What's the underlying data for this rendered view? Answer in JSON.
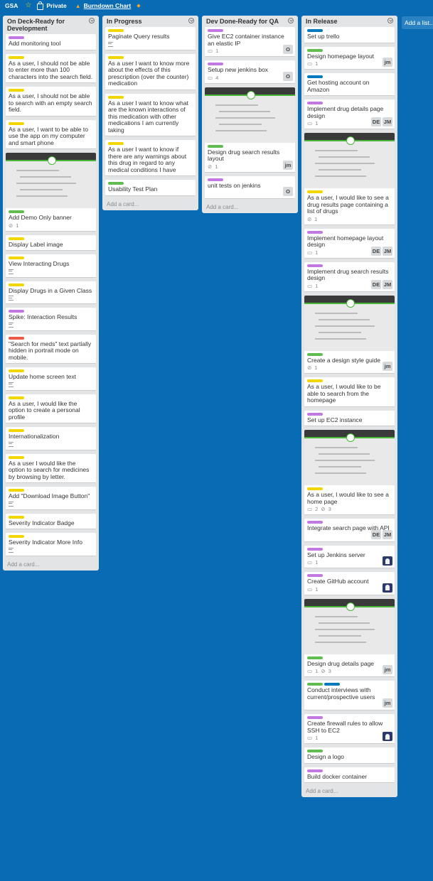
{
  "board": {
    "title": "GSA",
    "visibility": "Private",
    "link": "Burndown Chart",
    "add_list": "Add a list..."
  },
  "colors": {
    "background": "#0a6bb5",
    "yellow": "#f2d600",
    "purple": "#c377e0",
    "green": "#61bd4f",
    "blue": "#0079bf",
    "red": "#eb5a46"
  },
  "lists": [
    {
      "title": "On Deck-Ready for Development",
      "add_card": "Add a card...",
      "cards": [
        {
          "labels": [
            "purple"
          ],
          "title": "Add monitoring tool"
        },
        {
          "labels": [
            "yellow"
          ],
          "title": "As a user, I should not be able to enter more than 100 characters into the search field."
        },
        {
          "labels": [
            "yellow"
          ],
          "title": "As a user, I should not be able to search with an empty search field."
        },
        {
          "labels": [
            "yellow"
          ],
          "title": "As a user, I want to be able to use the app on my computer and smart phone"
        },
        {
          "labels": [
            "green"
          ],
          "title": "Add Demo Only banner",
          "attachments": "1",
          "cover": true
        },
        {
          "labels": [
            "yellow"
          ],
          "title": "Display Label image"
        },
        {
          "labels": [
            "yellow"
          ],
          "title": "View Interacting Drugs",
          "desc": true
        },
        {
          "labels": [
            "yellow"
          ],
          "title": "Display Drugs in a Given Class",
          "desc": true
        },
        {
          "labels": [
            "purple"
          ],
          "title": "Spike: Interaction Results",
          "desc": true
        },
        {
          "labels": [
            "red"
          ],
          "title": "\"Search for meds\" text partially hidden in portrait mode on mobile."
        },
        {
          "labels": [
            "yellow"
          ],
          "title": "Update home screen text",
          "desc": true
        },
        {
          "labels": [
            "yellow"
          ],
          "title": "As a user, I would like the option to create a personal profile"
        },
        {
          "labels": [
            "yellow"
          ],
          "title": "Internationalization",
          "desc": true
        },
        {
          "labels": [
            "yellow"
          ],
          "title": "As a user I would like the option to search for medicines by browsing by letter."
        },
        {
          "labels": [
            "yellow"
          ],
          "title": "Add \"Download Image Button\"",
          "desc": true
        },
        {
          "labels": [
            "yellow"
          ],
          "title": "Severity Indicator Badge"
        },
        {
          "labels": [
            "yellow"
          ],
          "title": "Severity Indicator More Info",
          "desc": true
        }
      ]
    },
    {
      "title": "In Progress",
      "add_card": "Add a card...",
      "cards": [
        {
          "labels": [
            "yellow"
          ],
          "title": "Paginate Query results",
          "desc": true
        },
        {
          "labels": [
            "yellow"
          ],
          "title": "As a user I want to know more about the effects of this prescription (over the counter) medication"
        },
        {
          "labels": [
            "yellow"
          ],
          "title": "As a user I want to know what are the known interactions of this medication with other medications I am currently taking"
        },
        {
          "labels": [
            "yellow"
          ],
          "title": "As a user I want to know if there are any warnings about this drug in regard to any medical conditions I have"
        },
        {
          "labels": [
            "green"
          ],
          "title": "Usability Test Plan"
        }
      ]
    },
    {
      "title": "Dev Done-Ready for QA",
      "add_card": "Add a card...",
      "cards": [
        {
          "labels": [
            "purple"
          ],
          "title": "Give EC2 container instance an elastic IP",
          "comments": "1",
          "members": [
            "O"
          ]
        },
        {
          "labels": [
            "purple"
          ],
          "title": "Setup new jenkins box",
          "comments": "4",
          "members": [
            "O"
          ]
        },
        {
          "labels": [
            "green"
          ],
          "title": "Design drug search results layout",
          "attachments": "1",
          "members": [
            "jm"
          ],
          "cover": true
        },
        {
          "labels": [
            "purple"
          ],
          "title": "unit tests on jenkins",
          "members": [
            "O"
          ]
        }
      ]
    },
    {
      "title": "In Release",
      "add_card": "Add a card...",
      "cards": [
        {
          "labels": [
            "blue"
          ],
          "title": "Set up trello"
        },
        {
          "labels": [
            "green"
          ],
          "title": "Design homepage layout",
          "comments": "1",
          "members": [
            "jm"
          ]
        },
        {
          "labels": [
            "blue"
          ],
          "title": "Get hosting account on Amazon"
        },
        {
          "labels": [
            "purple"
          ],
          "title": "Implement drug details page design",
          "comments": "1",
          "members": [
            "DE",
            "JM"
          ]
        },
        {
          "labels": [
            "yellow"
          ],
          "title": "As a user, I would like to see a drug results page containing a list of drugs",
          "attachments": "1",
          "cover": true
        },
        {
          "labels": [
            "purple"
          ],
          "title": "Implement homepage layout design",
          "comments": "1",
          "members": [
            "DE",
            "JM"
          ]
        },
        {
          "labels": [
            "purple"
          ],
          "title": "Implement drug search results design",
          "comments": "1",
          "members": [
            "DE",
            "JM"
          ]
        },
        {
          "labels": [
            "green"
          ],
          "title": "Create a design style guide",
          "attachments": "1",
          "members": [
            "jm"
          ],
          "cover": true
        },
        {
          "labels": [
            "yellow"
          ],
          "title": "As a user, I would like to be able to search from the homepage"
        },
        {
          "labels": [
            "purple"
          ],
          "title": "Set up EC2 instance"
        },
        {
          "labels": [
            "yellow"
          ],
          "title": "As a user, I would like to see a home page",
          "comments": "2",
          "attachments": "3",
          "cover": true
        },
        {
          "labels": [
            "purple"
          ],
          "title": "Integrate search page with API",
          "members": [
            "DE",
            "JM"
          ]
        },
        {
          "labels": [
            "purple"
          ],
          "title": "Set up Jenkins server",
          "comments": "1",
          "members": [
            "pic"
          ]
        },
        {
          "labels": [
            "purple"
          ],
          "title": "Create GitHub account",
          "comments": "1",
          "members": [
            "pic"
          ]
        },
        {
          "labels": [
            "green"
          ],
          "title": "Design drug details page",
          "comments": "1",
          "attachments": "3",
          "members": [
            "jm"
          ],
          "cover": true
        },
        {
          "labels": [
            "green",
            "blue"
          ],
          "title": "Conduct interviews with current/prospective users",
          "members": [
            "jm"
          ]
        },
        {
          "labels": [
            "purple"
          ],
          "title": "Create firewall rules to allow SSH to EC2",
          "comments": "1",
          "members": [
            "pic"
          ]
        },
        {
          "labels": [
            "green"
          ],
          "title": "Design a logo"
        },
        {
          "labels": [
            "purple"
          ],
          "title": "Build docker container"
        }
      ]
    }
  ]
}
